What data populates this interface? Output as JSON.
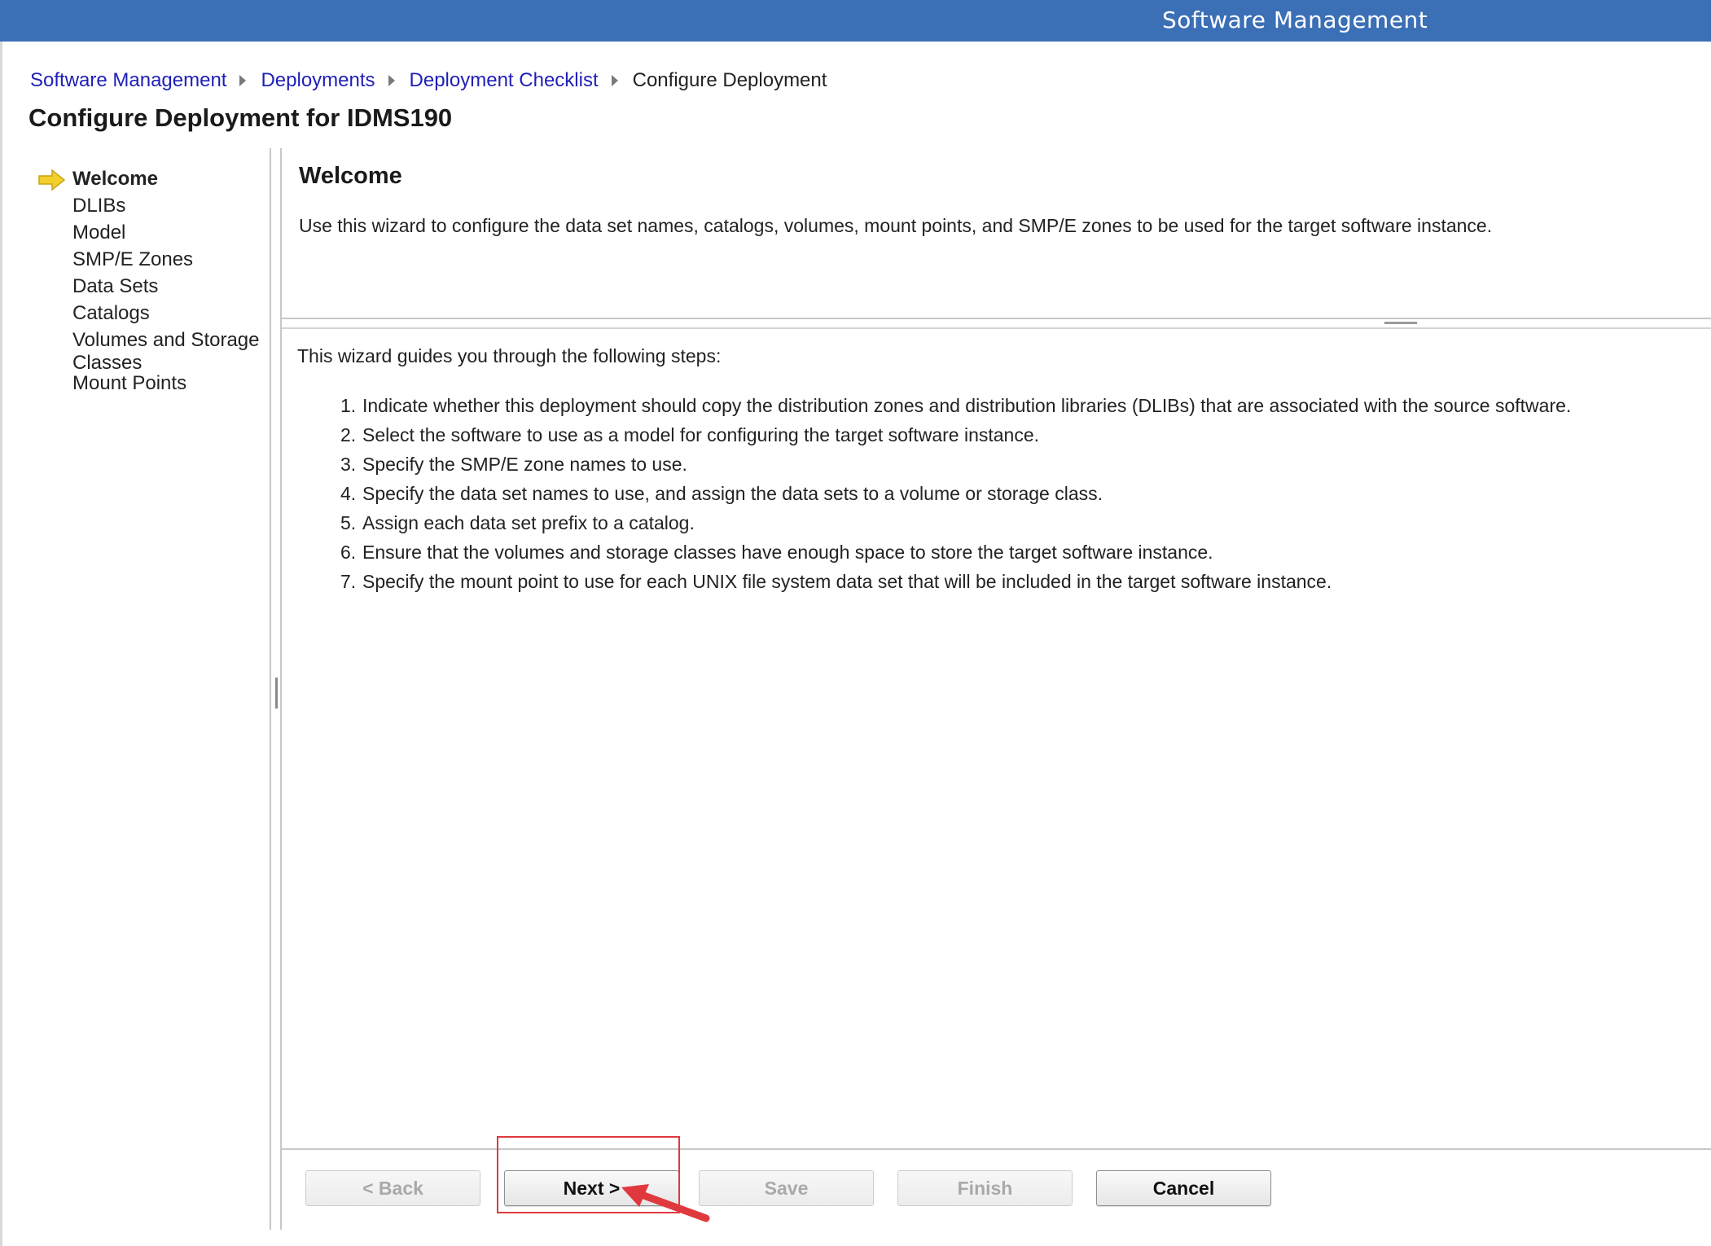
{
  "header": {
    "app_title": "Software Management"
  },
  "breadcrumb": {
    "items": [
      "Software Management",
      "Deployments",
      "Deployment Checklist"
    ],
    "current": "Configure Deployment"
  },
  "page": {
    "title": "Configure Deployment for IDMS190"
  },
  "nav": {
    "items": [
      {
        "label": "Welcome",
        "current": true
      },
      {
        "label": "DLIBs"
      },
      {
        "label": "Model"
      },
      {
        "label": "SMP/E Zones"
      },
      {
        "label": "Data Sets"
      },
      {
        "label": "Catalogs"
      },
      {
        "label": "Volumes and Storage Classes"
      },
      {
        "label": "Mount Points"
      }
    ]
  },
  "welcome": {
    "title": "Welcome",
    "description": "Use this wizard to configure the data set names, catalogs, volumes, mount points, and SMP/E zones to be used for the target software instance."
  },
  "steps": {
    "intro": "This wizard guides you through the following steps:",
    "items": [
      "Indicate whether this deployment should copy the distribution zones and distribution libraries (DLIBs) that are associated with the source software.",
      "Select the software to use as a model for configuring the target software instance.",
      "Specify the SMP/E zone names to use.",
      "Specify the data set names to use, and assign the data sets to a volume or storage class.",
      "Assign each data set prefix to a catalog.",
      "Ensure that the volumes and storage classes have enough space to store the target software instance.",
      "Specify the mount point to use for each UNIX file system data set that will be included in the target software instance."
    ]
  },
  "buttons": {
    "back": "< Back",
    "next": "Next >",
    "save": "Save",
    "finish": "Finish",
    "cancel": "Cancel"
  },
  "colors": {
    "header_bg": "#3b6fb6",
    "link": "#1f1fb8",
    "highlight": "#e0393d",
    "nav_arrow": "#f2cf2a"
  }
}
